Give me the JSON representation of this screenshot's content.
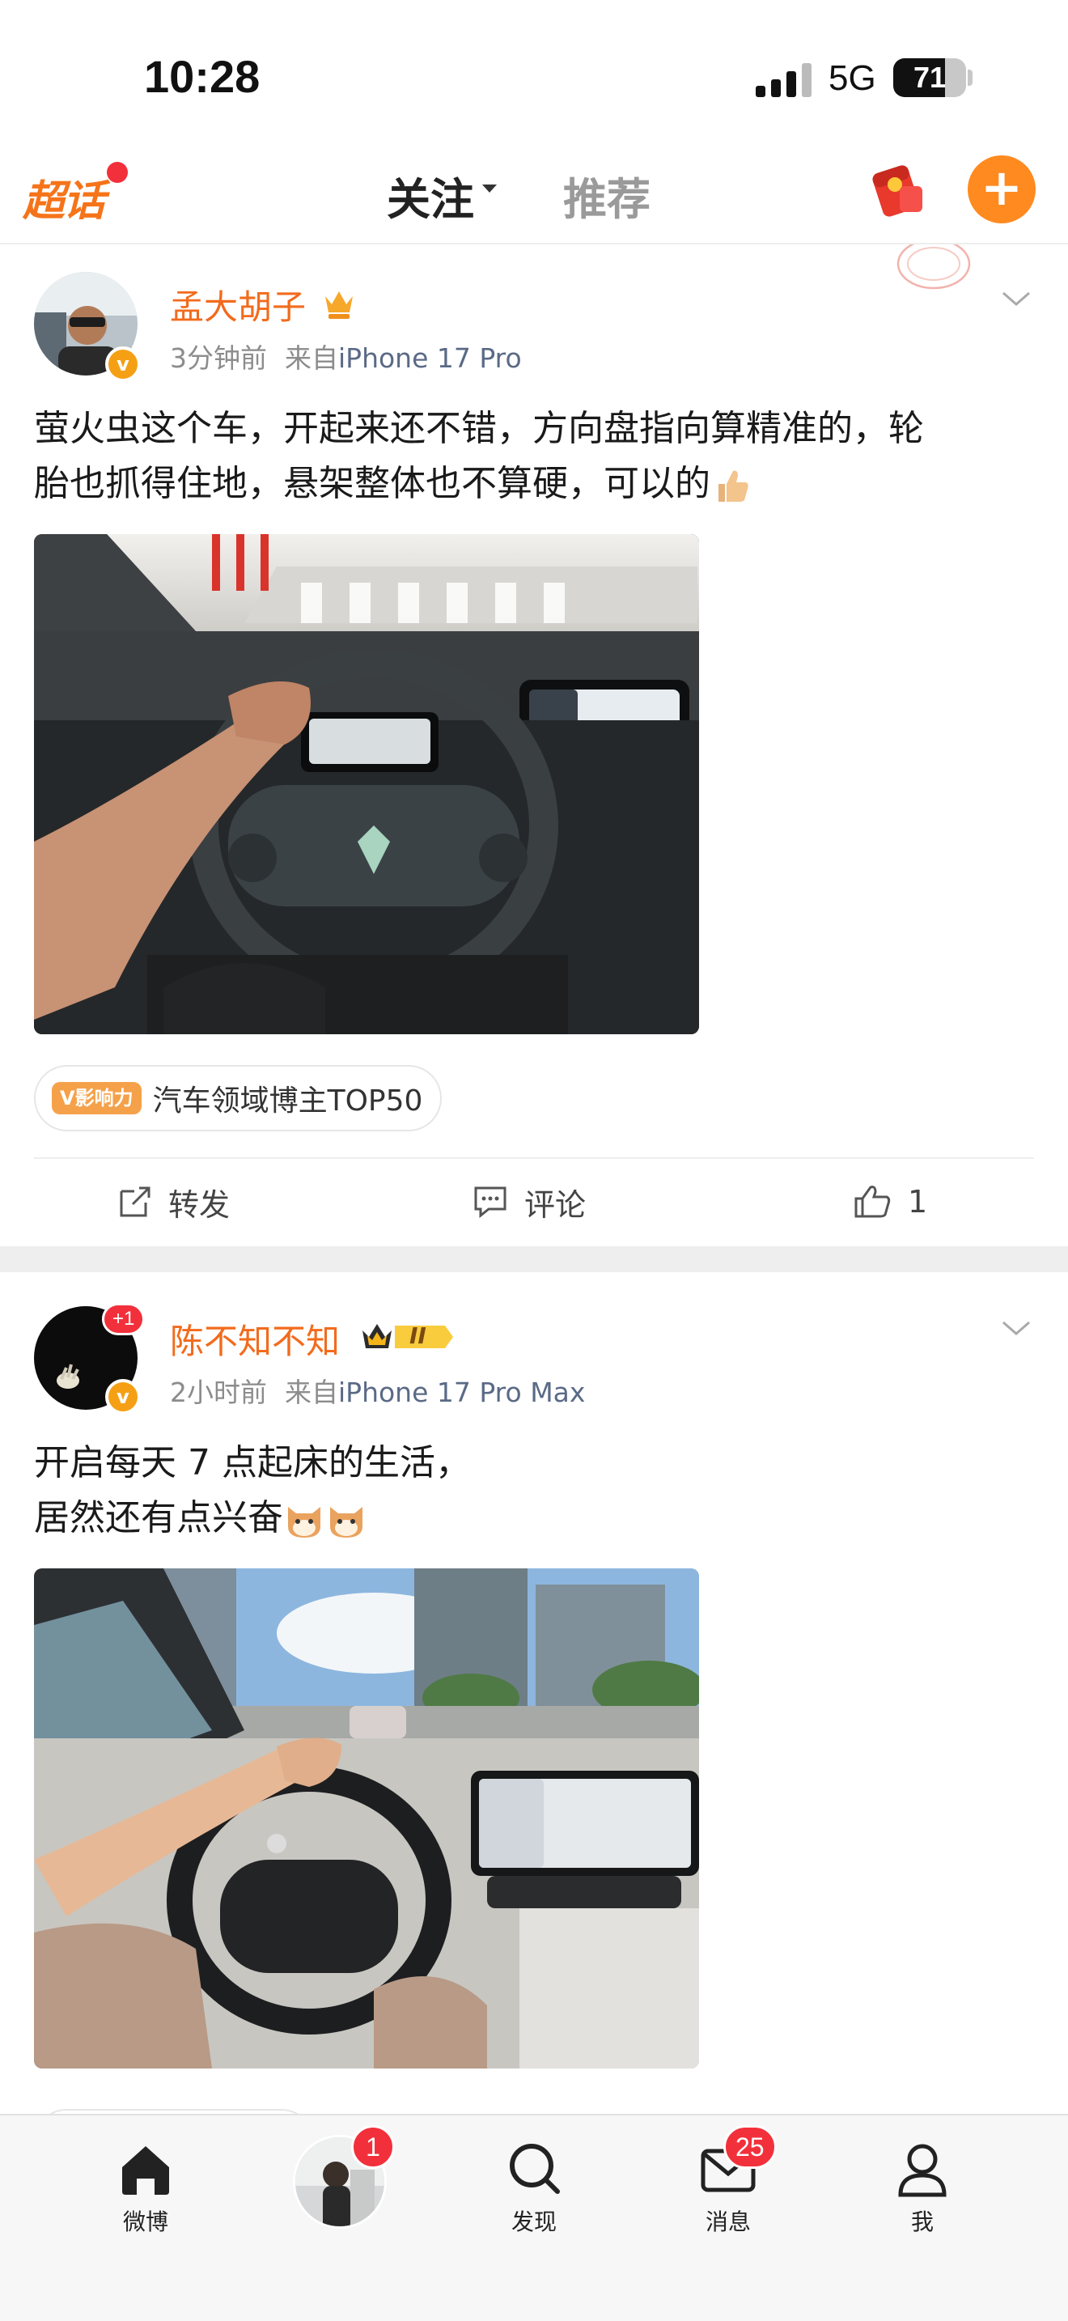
{
  "status_bar": {
    "time": "10:28",
    "network": "5G",
    "battery": "71",
    "battery_level": 0.71
  },
  "header": {
    "supertopic": "超话",
    "tab_follow": "关注",
    "tab_recommend": "推荐"
  },
  "posts": [
    {
      "author": "孟大胡子",
      "time": "3分钟前",
      "source_prefix": "来自",
      "device": "iPhone 17 Pro",
      "text_line1": "萤火虫这个车，开起来还不错，方向盘指向算精准的，轮",
      "text_line2": "胎也抓得住地，悬架整体也不算硬，可以的",
      "tag_badge": "V影响力",
      "tag_label": "汽车领域博主TOP50",
      "repost_label": "转发",
      "comment_label": "评论",
      "like_count": "1"
    },
    {
      "author": "陈不知不知",
      "plus_badge": "+1",
      "level_badge": "II",
      "time": "2小时前",
      "source_prefix": "来自",
      "device": "iPhone 17 Pro Max",
      "text_line1": "开启每天 7 点起床的生活，",
      "text_line2": "居然还有点兴奋"
    }
  ],
  "tabbar": {
    "weibo": "微博",
    "discover": "发现",
    "messages": "消息",
    "me": "我",
    "avatar_badge": "1",
    "messages_badge": "25"
  },
  "colors": {
    "accent": "#ff8a1f",
    "author": "#f26b1d",
    "badge": "#f2303b"
  }
}
